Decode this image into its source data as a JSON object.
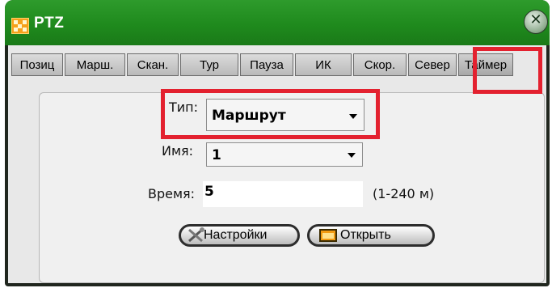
{
  "window": {
    "title": "PTZ",
    "close_glyph": "✕"
  },
  "tabs": [
    {
      "label": "Позиц"
    },
    {
      "label": "Марш."
    },
    {
      "label": "Скан."
    },
    {
      "label": "Тур"
    },
    {
      "label": "Пауза"
    },
    {
      "label": "ИК"
    },
    {
      "label": "Скор."
    },
    {
      "label": "Север"
    },
    {
      "label": "Таймер",
      "active": true
    }
  ],
  "form": {
    "type_label": "Тип:",
    "type_value": "Маршрут",
    "name_label": "Имя:",
    "name_value": "1",
    "time_label": "Время:",
    "time_value": "5",
    "time_hint": "(1-240 м)"
  },
  "buttons": {
    "settings_label": "Настройки",
    "open_label": "Открыть"
  },
  "colors": {
    "titlebar": "#1f8a1d",
    "highlight": "#e3212f",
    "app_icon": "#f6a11a"
  }
}
